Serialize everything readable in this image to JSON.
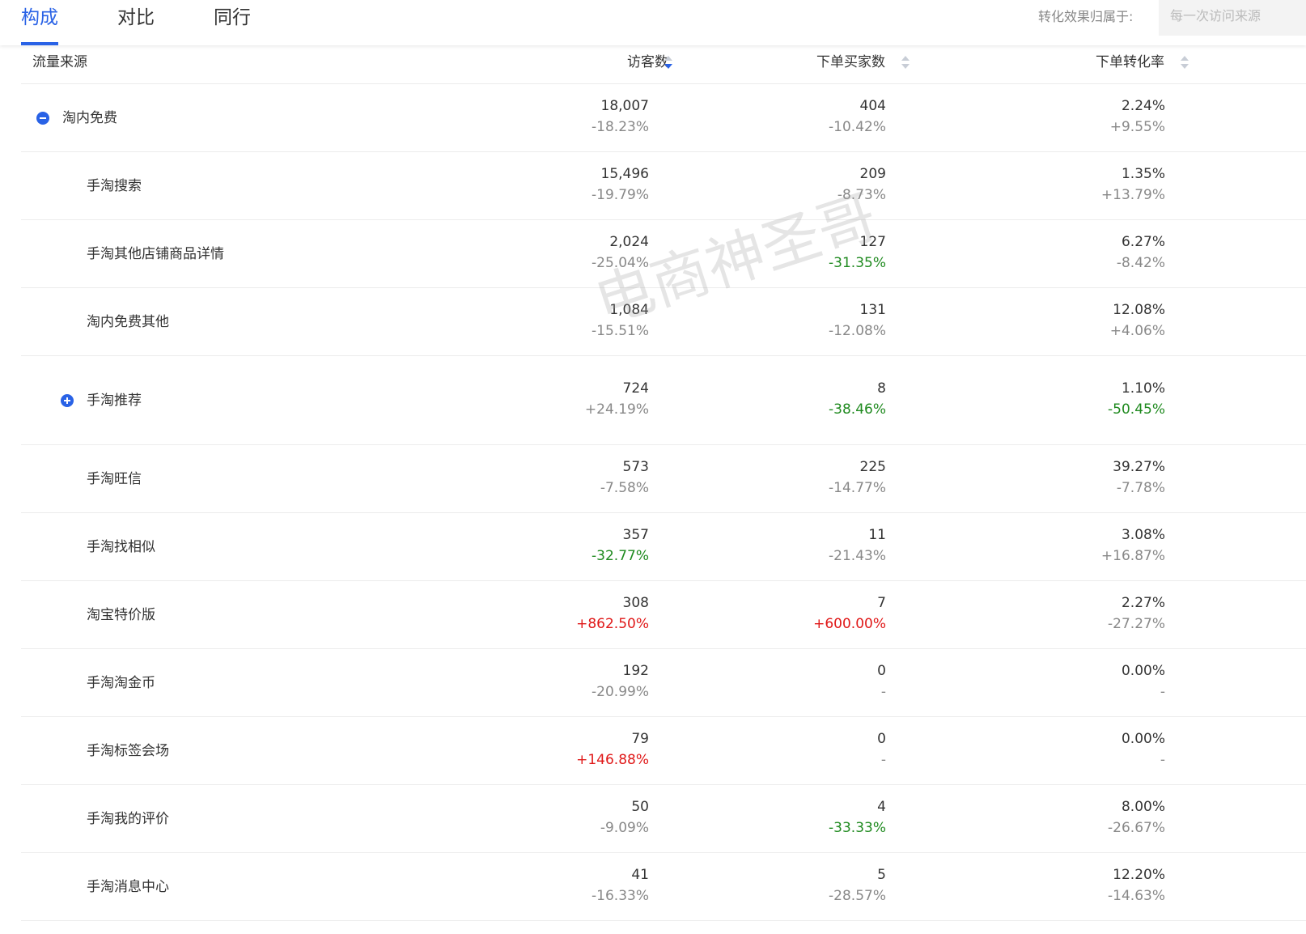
{
  "tabs": [
    {
      "label": "构成",
      "active": true
    },
    {
      "label": "对比",
      "active": false
    },
    {
      "label": "同行",
      "active": false
    }
  ],
  "attribution": {
    "label": "转化效果归属于:",
    "selected": "每一次访问来源"
  },
  "columns": {
    "source": "流量来源",
    "visitors": "访客数",
    "buyers": "下单买家数",
    "conversion": "下单转化率"
  },
  "rows": [
    {
      "name": "淘内免费",
      "toggle": "minus",
      "level": 0,
      "visitors": "18,007",
      "visitors_change": "-18.23%",
      "buyers": "404",
      "buyers_change": "-10.42%",
      "conversion": "2.24%",
      "conversion_change": "+9.55%"
    },
    {
      "name": "手淘搜索",
      "toggle": "",
      "level": 1,
      "visitors": "15,496",
      "visitors_change": "-19.79%",
      "buyers": "209",
      "buyers_change": "-8.73%",
      "conversion": "1.35%",
      "conversion_change": "+13.79%"
    },
    {
      "name": "手淘其他店铺商品详情",
      "toggle": "",
      "level": 1,
      "visitors": "2,024",
      "visitors_change": "-25.04%",
      "buyers": "127",
      "buyers_change": "-31.35%",
      "buyers_change_color": "down",
      "conversion": "6.27%",
      "conversion_change": "-8.42%"
    },
    {
      "name": "淘内免费其他",
      "toggle": "",
      "level": 1,
      "visitors": "1,084",
      "visitors_change": "-15.51%",
      "buyers": "131",
      "buyers_change": "-12.08%",
      "conversion": "12.08%",
      "conversion_change": "+4.06%"
    },
    {
      "name": "手淘推荐",
      "toggle": "plus",
      "level": 1,
      "visitors": "724",
      "visitors_change": "+24.19%",
      "buyers": "8",
      "buyers_change": "-38.46%",
      "buyers_change_color": "down",
      "conversion": "1.10%",
      "conversion_change": "-50.45%",
      "conversion_change_color": "down"
    },
    {
      "name": "手淘旺信",
      "toggle": "",
      "level": 1,
      "visitors": "573",
      "visitors_change": "-7.58%",
      "buyers": "225",
      "buyers_change": "-14.77%",
      "conversion": "39.27%",
      "conversion_change": "-7.78%"
    },
    {
      "name": "手淘找相似",
      "toggle": "",
      "level": 1,
      "visitors": "357",
      "visitors_change": "-32.77%",
      "visitors_change_color": "down",
      "buyers": "11",
      "buyers_change": "-21.43%",
      "conversion": "3.08%",
      "conversion_change": "+16.87%"
    },
    {
      "name": "淘宝特价版",
      "toggle": "",
      "level": 1,
      "visitors": "308",
      "visitors_change": "+862.50%",
      "visitors_change_color": "up",
      "buyers": "7",
      "buyers_change": "+600.00%",
      "buyers_change_color": "up",
      "conversion": "2.27%",
      "conversion_change": "-27.27%"
    },
    {
      "name": "手淘淘金币",
      "toggle": "",
      "level": 1,
      "visitors": "192",
      "visitors_change": "-20.99%",
      "buyers": "0",
      "buyers_change": "-",
      "conversion": "0.00%",
      "conversion_change": "-"
    },
    {
      "name": "手淘标签会场",
      "toggle": "",
      "level": 1,
      "visitors": "79",
      "visitors_change": "+146.88%",
      "visitors_change_color": "up",
      "buyers": "0",
      "buyers_change": "-",
      "conversion": "0.00%",
      "conversion_change": "-"
    },
    {
      "name": "手淘我的评价",
      "toggle": "",
      "level": 1,
      "visitors": "50",
      "visitors_change": "-9.09%",
      "buyers": "4",
      "buyers_change": "-33.33%",
      "buyers_change_color": "down",
      "conversion": "8.00%",
      "conversion_change": "-26.67%"
    },
    {
      "name": "手淘消息中心",
      "toggle": "",
      "level": 1,
      "visitors": "41",
      "visitors_change": "-16.33%",
      "buyers": "5",
      "buyers_change": "-28.57%",
      "conversion": "12.20%",
      "conversion_change": "-14.63%"
    }
  ],
  "watermark": "电商神圣哥",
  "colors": {
    "accent": "#2962e6",
    "decrease": "#1f8a1f",
    "increase": "#e01818"
  }
}
